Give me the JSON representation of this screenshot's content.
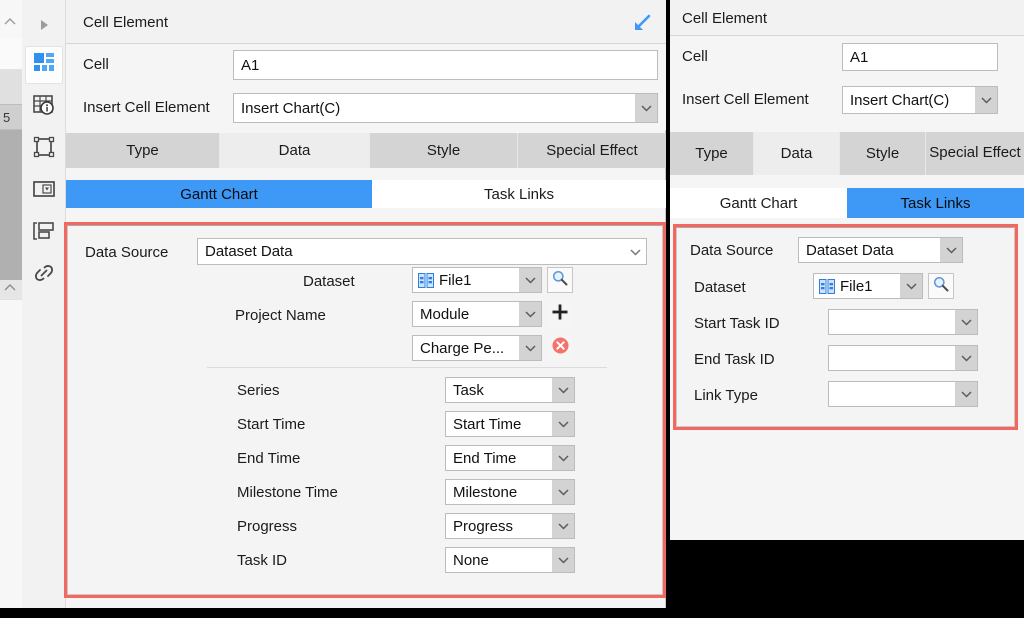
{
  "left_panel": {
    "title": "Cell Element",
    "collapse_icon": "arrow-down-left-icon",
    "fields": {
      "cell_label": "Cell",
      "cell_value": "A1",
      "insert_label": "Insert Cell Element",
      "insert_value": "Insert Chart(C)"
    },
    "tabs": [
      {
        "label": "Type",
        "active": false
      },
      {
        "label": "Data",
        "active": true
      },
      {
        "label": "Style",
        "active": false
      },
      {
        "label": "Special Effect",
        "active": false
      }
    ],
    "subtabs": [
      {
        "label": "Gantt Chart",
        "active": true
      },
      {
        "label": "Task Links",
        "active": false
      }
    ],
    "form": {
      "data_source_label": "Data Source",
      "data_source_value": "Dataset Data",
      "dataset_label": "Dataset",
      "dataset_value": "File1",
      "dataset_icon": "dataset-table-icon",
      "search_icon": "search-icon",
      "project_name_label": "Project Name",
      "project_name_value": "Module",
      "add_icon": "plus-icon",
      "charge_value": "Charge Pe...",
      "remove_icon": "remove-circle-icon",
      "rows": [
        {
          "label": "Series",
          "value": "Task"
        },
        {
          "label": "Start Time",
          "value": "Start Time"
        },
        {
          "label": "End Time",
          "value": "End Time"
        },
        {
          "label": "Milestone Time",
          "value": "Milestone"
        },
        {
          "label": "Progress",
          "value": "Progress"
        },
        {
          "label": "Task ID",
          "value": "None"
        }
      ]
    }
  },
  "right_panel": {
    "title": "Cell Element",
    "fields": {
      "cell_label": "Cell",
      "cell_value": "A1",
      "insert_label": "Insert Cell Element",
      "insert_value": "Insert Chart(C)"
    },
    "tabs": [
      {
        "label": "Type",
        "active": false
      },
      {
        "label": "Data",
        "active": true
      },
      {
        "label": "Style",
        "active": false
      },
      {
        "label": "Special Effect",
        "active": false
      }
    ],
    "subtabs": [
      {
        "label": "Gantt Chart",
        "active": false
      },
      {
        "label": "Task Links",
        "active": true
      }
    ],
    "form": {
      "data_source_label": "Data Source",
      "data_source_value": "Dataset Data",
      "dataset_label": "Dataset",
      "dataset_value": "File1",
      "dataset_icon": "dataset-table-icon",
      "search_icon": "search-icon",
      "rows": [
        {
          "label": "Start Task ID",
          "value": ""
        },
        {
          "label": "End Task ID",
          "value": ""
        },
        {
          "label": "Link Type",
          "value": ""
        }
      ]
    }
  },
  "sidebar_rail": {
    "items": [
      {
        "icon": "triangle-right-icon",
        "selected": false
      },
      {
        "icon": "grid-blocks-icon",
        "selected": true
      },
      {
        "icon": "table-info-icon",
        "selected": false
      },
      {
        "icon": "frame-icon",
        "selected": false
      },
      {
        "icon": "dropdown-box-icon",
        "selected": false
      },
      {
        "icon": "layers-panel-icon",
        "selected": false
      },
      {
        "icon": "link-chain-icon",
        "selected": false
      }
    ]
  },
  "edge_strip": {
    "row_number": "5",
    "chevron_top": "chevron-up-icon",
    "chevron_bottom": "chevron-up-icon"
  },
  "colors": {
    "accent_blue": "#3d99f5",
    "highlight_red": "#f4675f",
    "panel_bg": "#f5f5f5",
    "tab_bg": "#d4d4d4"
  }
}
